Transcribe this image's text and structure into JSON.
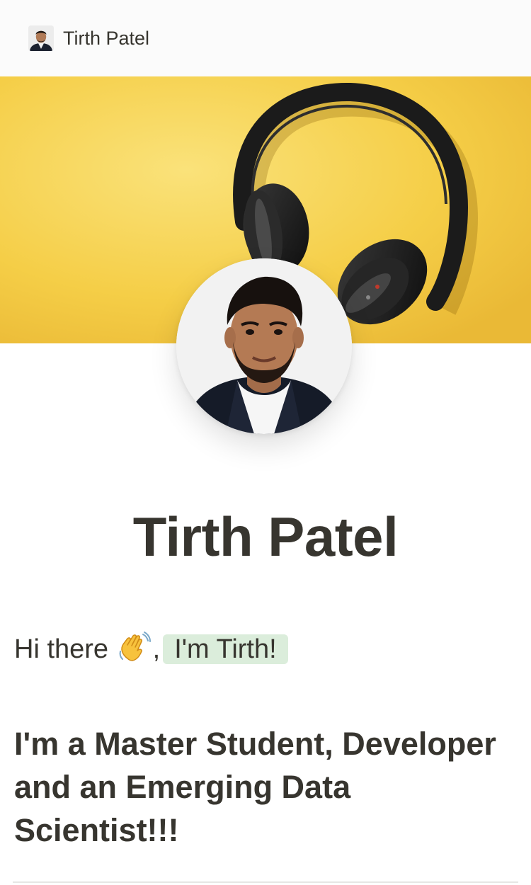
{
  "topbar": {
    "title": "Tirth Patel",
    "avatar_icon": "profile-avatar-icon"
  },
  "cover": {
    "image": "yellow-headphones-cover"
  },
  "profile": {
    "image": "profile-photo"
  },
  "page": {
    "title": "Tirth Patel"
  },
  "greeting": {
    "text_before": "Hi there ",
    "emoji_icon": "waving-hand-icon",
    "comma": ",",
    "highlight": "I'm Tirth!"
  },
  "intro": {
    "text": "I'm a Master Student, Developer and an Emerging Data Scientist!!!"
  },
  "colors": {
    "cover_yellow": "#f5cd45",
    "highlight_green": "#dbeddb",
    "text": "#37352f"
  }
}
